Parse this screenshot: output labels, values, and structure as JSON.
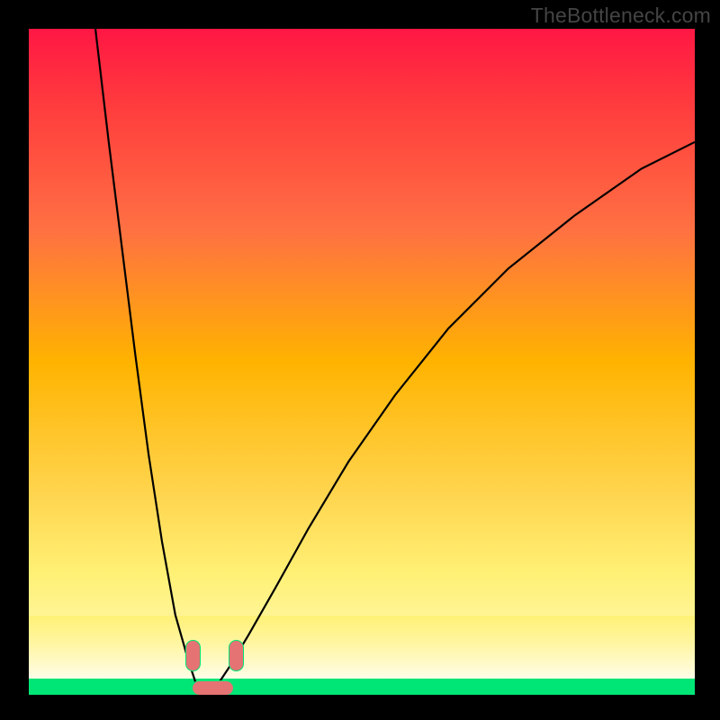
{
  "watermark": "TheBottleneck.com",
  "chart_data": {
    "type": "line",
    "title": "",
    "xlabel": "",
    "ylabel": "",
    "xlim": [
      0,
      100
    ],
    "ylim": [
      0,
      100
    ],
    "series": [
      {
        "name": "left-arm",
        "x": [
          10,
          12,
          14,
          16,
          18,
          20,
          22,
          24,
          25,
          26,
          27
        ],
        "y": [
          100,
          83,
          67,
          51,
          36,
          23,
          12,
          5,
          2,
          0.5,
          0
        ]
      },
      {
        "name": "right-arm",
        "x": [
          27,
          28,
          30,
          33,
          37,
          42,
          48,
          55,
          63,
          72,
          82,
          92,
          100
        ],
        "y": [
          0,
          1,
          4,
          9,
          16,
          25,
          35,
          45,
          55,
          64,
          72,
          79,
          83
        ]
      }
    ],
    "gradient_stops": [
      {
        "pos": 0.0,
        "color": "#ff1744"
      },
      {
        "pos": 0.12,
        "color": "#ff3d3d"
      },
      {
        "pos": 0.3,
        "color": "#ff7043"
      },
      {
        "pos": 0.5,
        "color": "#ffb300"
      },
      {
        "pos": 0.7,
        "color": "#ffd54f"
      },
      {
        "pos": 0.82,
        "color": "#fff176"
      },
      {
        "pos": 0.9,
        "color": "#fff59d"
      },
      {
        "pos": 0.97,
        "color": "#b9f6ca"
      },
      {
        "pos": 1.0,
        "color": "#00e676"
      }
    ],
    "markers": [
      {
        "name": "marker-left",
        "x": 24.5,
        "y": 6,
        "w": 2,
        "h": 4.5
      },
      {
        "name": "marker-right",
        "x": 31.0,
        "y": 6,
        "w": 2,
        "h": 4.5
      },
      {
        "name": "marker-bottom",
        "x": 27.5,
        "y": 1.2,
        "w": 6,
        "h": 2
      }
    ]
  }
}
